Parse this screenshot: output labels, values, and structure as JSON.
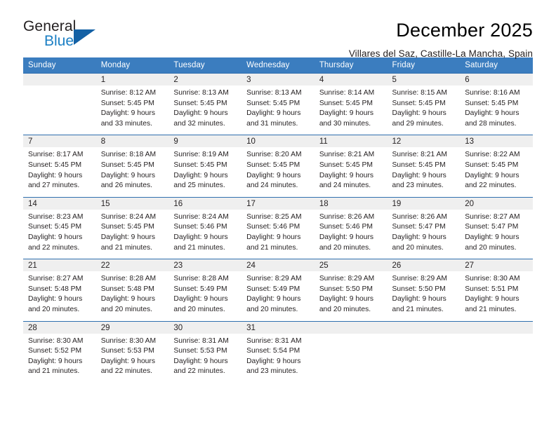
{
  "brand": {
    "name_primary": "General",
    "name_secondary": "Blue",
    "accent_color": "#1461a5",
    "secondary_color": "#1b7fc4"
  },
  "header": {
    "title": "December 2025",
    "subtitle": "Villares del Saz, Castille-La Mancha, Spain"
  },
  "calendar": {
    "header_bg": "#3b7dbf",
    "daynum_bg": "#efefef",
    "weekday_headers": [
      "Sunday",
      "Monday",
      "Tuesday",
      "Wednesday",
      "Thursday",
      "Friday",
      "Saturday"
    ],
    "weeks": [
      [
        {
          "day": "",
          "lines": [
            "",
            "",
            "",
            ""
          ]
        },
        {
          "day": "1",
          "lines": [
            "Sunrise: 8:12 AM",
            "Sunset: 5:45 PM",
            "Daylight: 9 hours",
            "and 33 minutes."
          ]
        },
        {
          "day": "2",
          "lines": [
            "Sunrise: 8:13 AM",
            "Sunset: 5:45 PM",
            "Daylight: 9 hours",
            "and 32 minutes."
          ]
        },
        {
          "day": "3",
          "lines": [
            "Sunrise: 8:13 AM",
            "Sunset: 5:45 PM",
            "Daylight: 9 hours",
            "and 31 minutes."
          ]
        },
        {
          "day": "4",
          "lines": [
            "Sunrise: 8:14 AM",
            "Sunset: 5:45 PM",
            "Daylight: 9 hours",
            "and 30 minutes."
          ]
        },
        {
          "day": "5",
          "lines": [
            "Sunrise: 8:15 AM",
            "Sunset: 5:45 PM",
            "Daylight: 9 hours",
            "and 29 minutes."
          ]
        },
        {
          "day": "6",
          "lines": [
            "Sunrise: 8:16 AM",
            "Sunset: 5:45 PM",
            "Daylight: 9 hours",
            "and 28 minutes."
          ]
        }
      ],
      [
        {
          "day": "7",
          "lines": [
            "Sunrise: 8:17 AM",
            "Sunset: 5:45 PM",
            "Daylight: 9 hours",
            "and 27 minutes."
          ]
        },
        {
          "day": "8",
          "lines": [
            "Sunrise: 8:18 AM",
            "Sunset: 5:45 PM",
            "Daylight: 9 hours",
            "and 26 minutes."
          ]
        },
        {
          "day": "9",
          "lines": [
            "Sunrise: 8:19 AM",
            "Sunset: 5:45 PM",
            "Daylight: 9 hours",
            "and 25 minutes."
          ]
        },
        {
          "day": "10",
          "lines": [
            "Sunrise: 8:20 AM",
            "Sunset: 5:45 PM",
            "Daylight: 9 hours",
            "and 24 minutes."
          ]
        },
        {
          "day": "11",
          "lines": [
            "Sunrise: 8:21 AM",
            "Sunset: 5:45 PM",
            "Daylight: 9 hours",
            "and 24 minutes."
          ]
        },
        {
          "day": "12",
          "lines": [
            "Sunrise: 8:21 AM",
            "Sunset: 5:45 PM",
            "Daylight: 9 hours",
            "and 23 minutes."
          ]
        },
        {
          "day": "13",
          "lines": [
            "Sunrise: 8:22 AM",
            "Sunset: 5:45 PM",
            "Daylight: 9 hours",
            "and 22 minutes."
          ]
        }
      ],
      [
        {
          "day": "14",
          "lines": [
            "Sunrise: 8:23 AM",
            "Sunset: 5:45 PM",
            "Daylight: 9 hours",
            "and 22 minutes."
          ]
        },
        {
          "day": "15",
          "lines": [
            "Sunrise: 8:24 AM",
            "Sunset: 5:45 PM",
            "Daylight: 9 hours",
            "and 21 minutes."
          ]
        },
        {
          "day": "16",
          "lines": [
            "Sunrise: 8:24 AM",
            "Sunset: 5:46 PM",
            "Daylight: 9 hours",
            "and 21 minutes."
          ]
        },
        {
          "day": "17",
          "lines": [
            "Sunrise: 8:25 AM",
            "Sunset: 5:46 PM",
            "Daylight: 9 hours",
            "and 21 minutes."
          ]
        },
        {
          "day": "18",
          "lines": [
            "Sunrise: 8:26 AM",
            "Sunset: 5:46 PM",
            "Daylight: 9 hours",
            "and 20 minutes."
          ]
        },
        {
          "day": "19",
          "lines": [
            "Sunrise: 8:26 AM",
            "Sunset: 5:47 PM",
            "Daylight: 9 hours",
            "and 20 minutes."
          ]
        },
        {
          "day": "20",
          "lines": [
            "Sunrise: 8:27 AM",
            "Sunset: 5:47 PM",
            "Daylight: 9 hours",
            "and 20 minutes."
          ]
        }
      ],
      [
        {
          "day": "21",
          "lines": [
            "Sunrise: 8:27 AM",
            "Sunset: 5:48 PM",
            "Daylight: 9 hours",
            "and 20 minutes."
          ]
        },
        {
          "day": "22",
          "lines": [
            "Sunrise: 8:28 AM",
            "Sunset: 5:48 PM",
            "Daylight: 9 hours",
            "and 20 minutes."
          ]
        },
        {
          "day": "23",
          "lines": [
            "Sunrise: 8:28 AM",
            "Sunset: 5:49 PM",
            "Daylight: 9 hours",
            "and 20 minutes."
          ]
        },
        {
          "day": "24",
          "lines": [
            "Sunrise: 8:29 AM",
            "Sunset: 5:49 PM",
            "Daylight: 9 hours",
            "and 20 minutes."
          ]
        },
        {
          "day": "25",
          "lines": [
            "Sunrise: 8:29 AM",
            "Sunset: 5:50 PM",
            "Daylight: 9 hours",
            "and 20 minutes."
          ]
        },
        {
          "day": "26",
          "lines": [
            "Sunrise: 8:29 AM",
            "Sunset: 5:50 PM",
            "Daylight: 9 hours",
            "and 21 minutes."
          ]
        },
        {
          "day": "27",
          "lines": [
            "Sunrise: 8:30 AM",
            "Sunset: 5:51 PM",
            "Daylight: 9 hours",
            "and 21 minutes."
          ]
        }
      ],
      [
        {
          "day": "28",
          "lines": [
            "Sunrise: 8:30 AM",
            "Sunset: 5:52 PM",
            "Daylight: 9 hours",
            "and 21 minutes."
          ]
        },
        {
          "day": "29",
          "lines": [
            "Sunrise: 8:30 AM",
            "Sunset: 5:53 PM",
            "Daylight: 9 hours",
            "and 22 minutes."
          ]
        },
        {
          "day": "30",
          "lines": [
            "Sunrise: 8:31 AM",
            "Sunset: 5:53 PM",
            "Daylight: 9 hours",
            "and 22 minutes."
          ]
        },
        {
          "day": "31",
          "lines": [
            "Sunrise: 8:31 AM",
            "Sunset: 5:54 PM",
            "Daylight: 9 hours",
            "and 23 minutes."
          ]
        },
        {
          "day": "",
          "lines": [
            "",
            "",
            "",
            ""
          ]
        },
        {
          "day": "",
          "lines": [
            "",
            "",
            "",
            ""
          ]
        },
        {
          "day": "",
          "lines": [
            "",
            "",
            "",
            ""
          ]
        }
      ]
    ]
  }
}
